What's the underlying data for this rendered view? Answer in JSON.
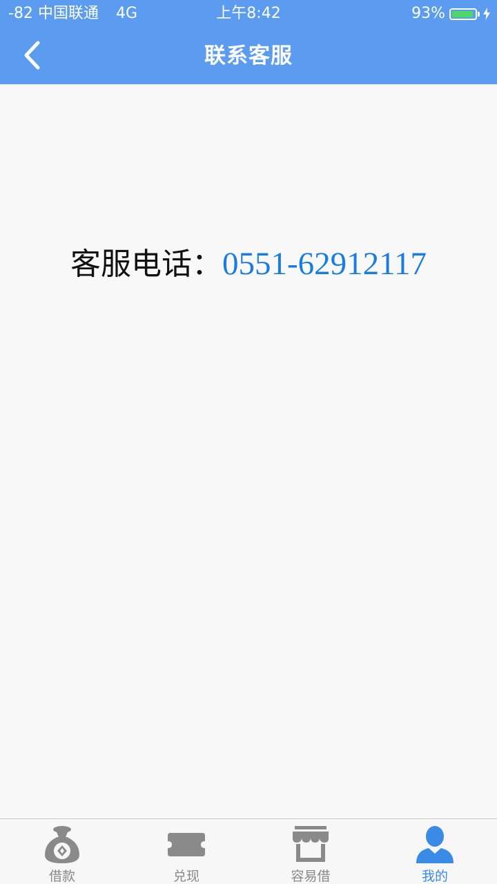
{
  "status_bar": {
    "signal": "-82",
    "carrier": "中国联通",
    "network": "4G",
    "time": "上午8:42",
    "battery_percent": "93%",
    "battery_level": 0.93
  },
  "nav": {
    "title": "联系客服"
  },
  "content": {
    "phone_label": "客服电话：",
    "phone_number": "0551-62912117"
  },
  "tabs": [
    {
      "label": "借款",
      "icon": "money-bag-icon",
      "active": false
    },
    {
      "label": "兑现",
      "icon": "ticket-icon",
      "active": false
    },
    {
      "label": "容易借",
      "icon": "store-icon",
      "active": false
    },
    {
      "label": "我的",
      "icon": "user-icon",
      "active": true
    }
  ],
  "colors": {
    "header": "#5b9cf0",
    "phone_number": "#1a7be0",
    "tab_active": "#3a8ae8",
    "tab_inactive": "#888888",
    "battery_fill": "#4cd964"
  }
}
